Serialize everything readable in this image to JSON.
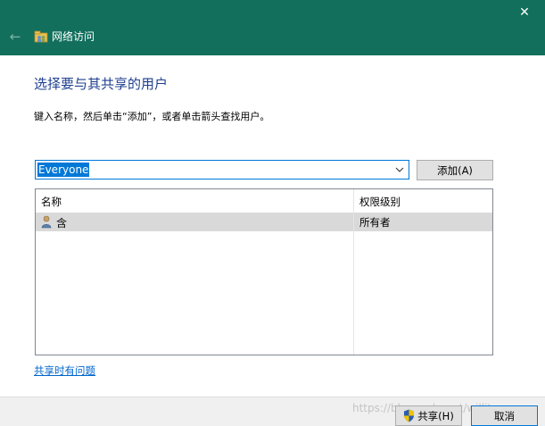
{
  "window": {
    "title": "网络访问",
    "close_glyph": "✕",
    "back_glyph": "←",
    "title_bar_color": "#126f5c"
  },
  "content": {
    "heading": "选择要与其共享的用户",
    "instruction": "键入名称，然后单击“添加”，或者单击箭头查找用户。"
  },
  "user_combo": {
    "value": "Everyone"
  },
  "add_button": {
    "label": "添加(A)"
  },
  "list": {
    "columns": [
      "名称",
      "权限级别"
    ],
    "rows": [
      {
        "name": "含",
        "permission": "所有者",
        "icon": "user-icon"
      }
    ]
  },
  "help_link": {
    "label": "共享时有问题"
  },
  "footer": {
    "share_label": "共享(H)",
    "cancel_label": "取消",
    "watermark": "https://blog.csdn.net/willitscan"
  }
}
